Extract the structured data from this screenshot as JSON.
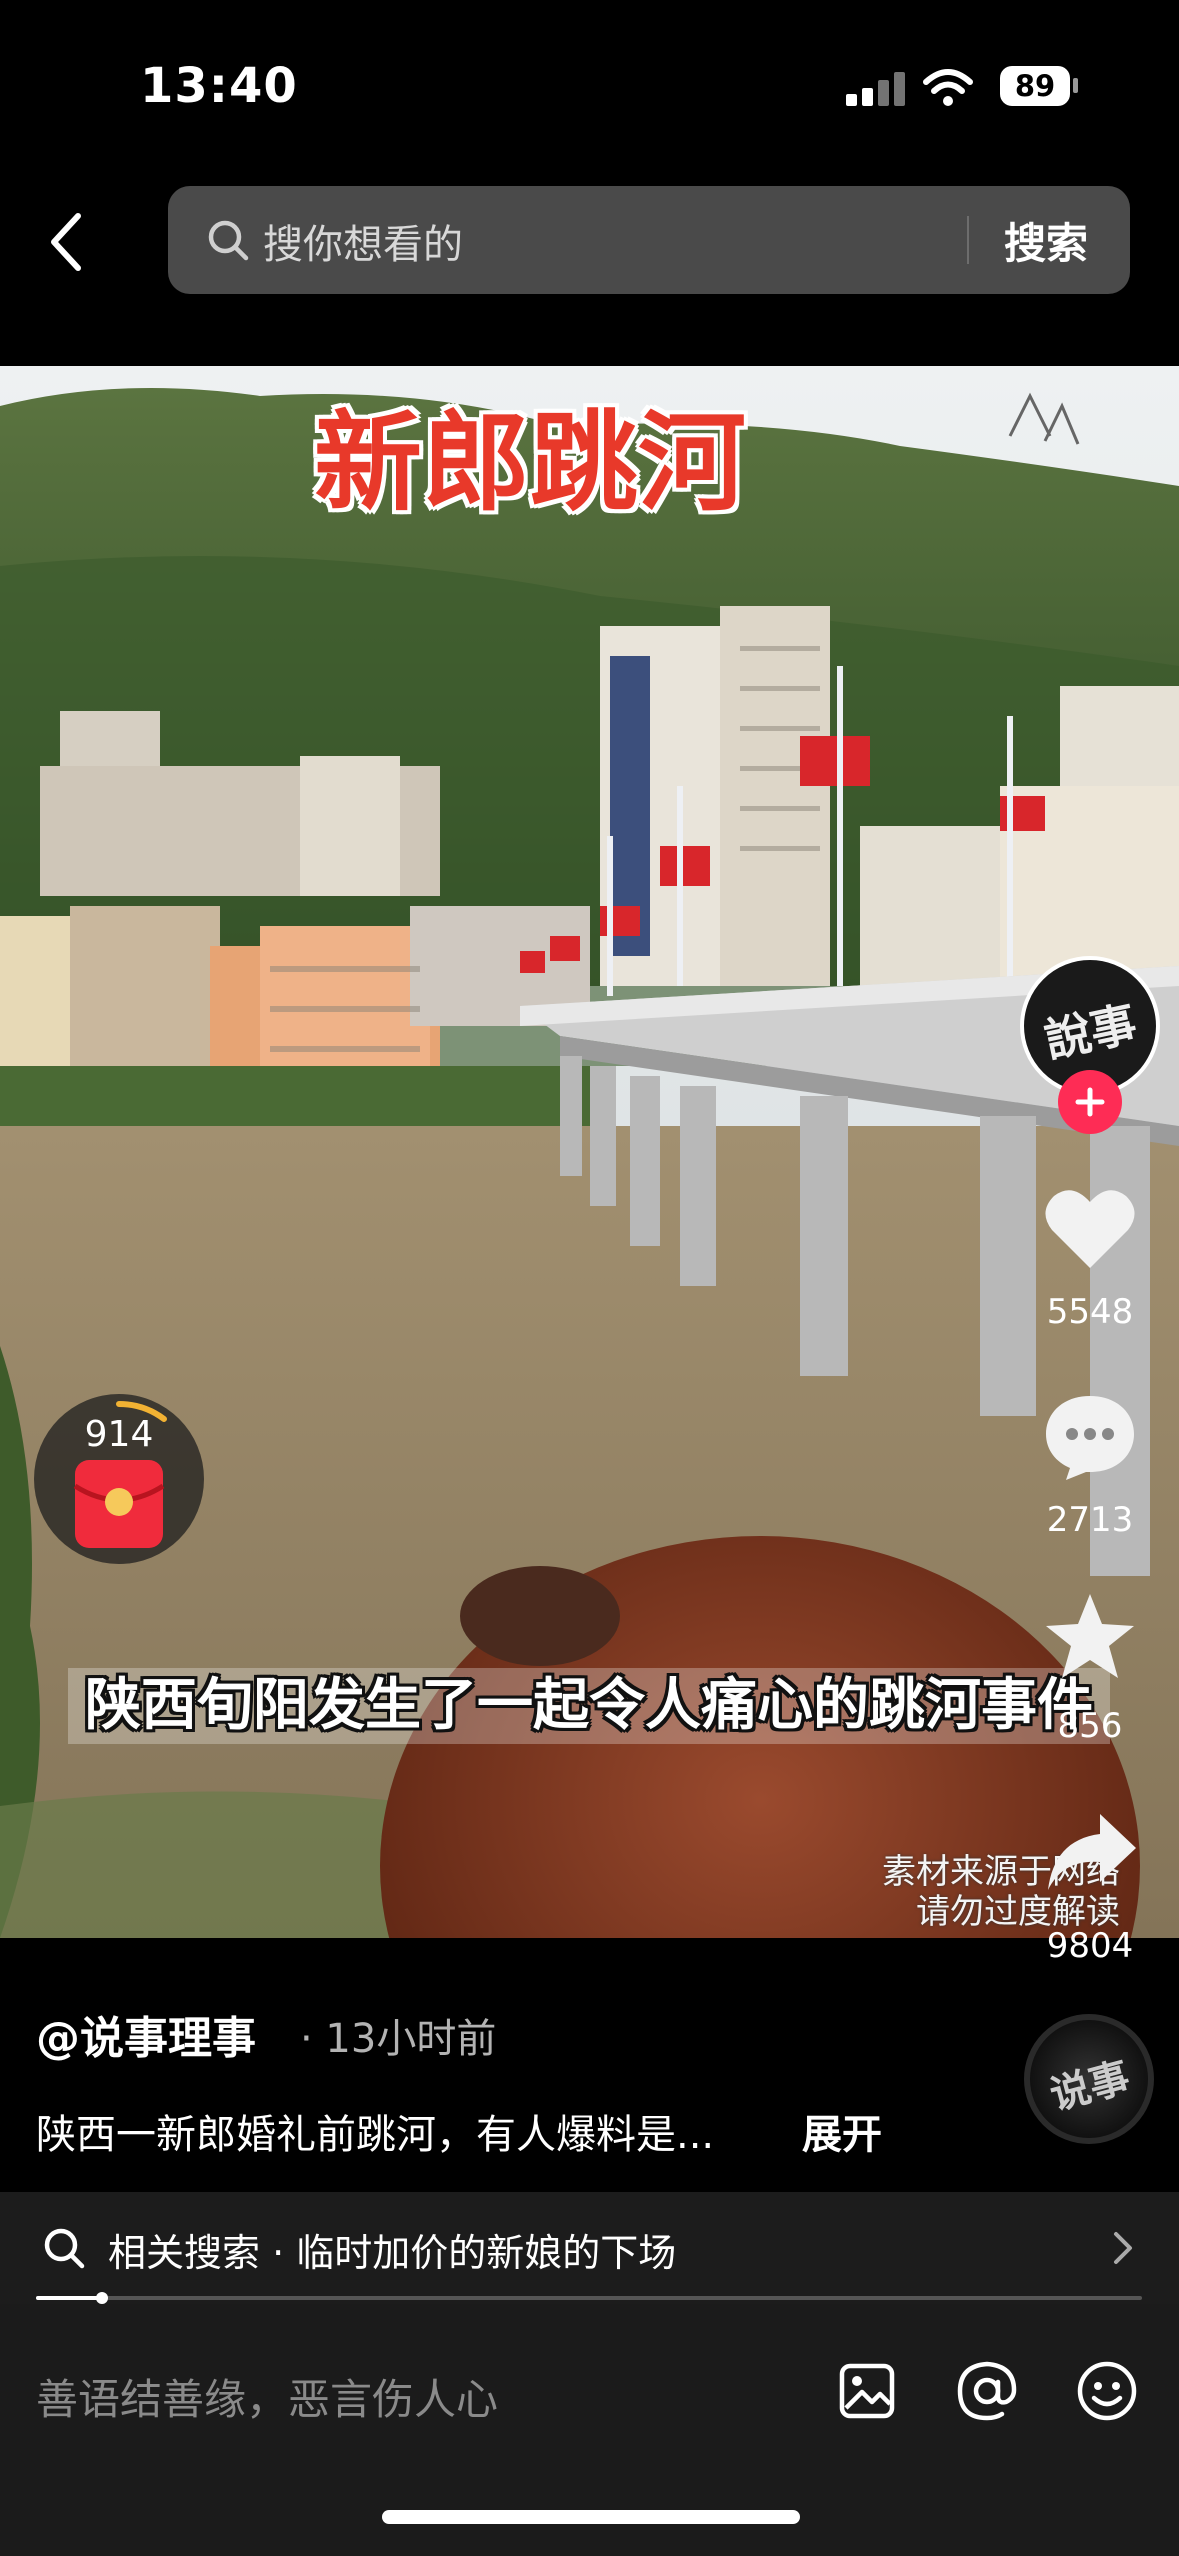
{
  "status_bar": {
    "time": "13:40",
    "battery": "89",
    "icons": [
      "cellular-signal-icon",
      "wifi-icon",
      "battery-icon"
    ]
  },
  "search": {
    "placeholder": "搜你想看的",
    "button_label": "搜索",
    "back_icon": "chevron-left-icon",
    "search_icon": "search-icon"
  },
  "video": {
    "title_overlay": "新郎跳河",
    "subtitle": "陕西旬阳发生了一起令人痛心的跳河事件",
    "disclaimer_line1": "素材来源于网络",
    "disclaimer_line2": "请勿过度解读",
    "sign_text": "说事",
    "red_packet_count": "914"
  },
  "right_rail": {
    "avatar_text": "說事",
    "likes": "5548",
    "comments": "2713",
    "favorites": "856",
    "shares": "9804"
  },
  "caption": {
    "author": "@说事理事",
    "time_ago": "· 13小时前",
    "description": "陕西一新郎婚礼前跳河，有人爆料是...",
    "expand_label": "展开"
  },
  "related": {
    "text": "相关搜索 · 临时加价的新娘的下场"
  },
  "progress": {
    "fraction": 0.06
  },
  "comment_bar": {
    "placeholder": "善语结善缘，恶言伤人心",
    "icons": [
      "image-icon",
      "at-icon",
      "emoji-icon"
    ]
  },
  "colors": {
    "accent_red": "#fe2c55",
    "title_red": "#e8392a"
  }
}
